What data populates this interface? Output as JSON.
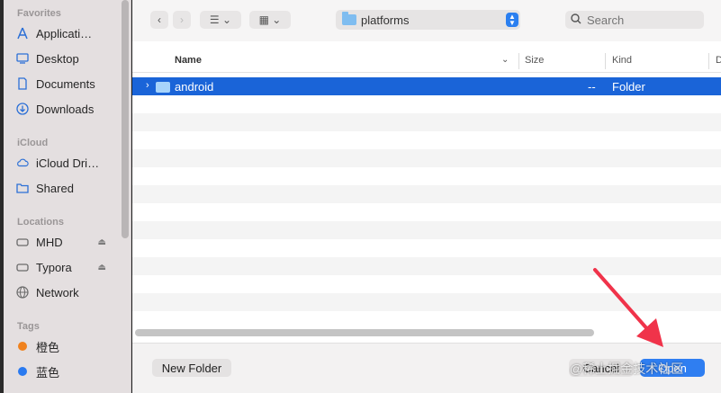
{
  "sidebar": {
    "favorites_title": "Favorites",
    "favorites": [
      {
        "label": "Applicati…",
        "icon": "applications-icon"
      },
      {
        "label": "Desktop",
        "icon": "desktop-icon"
      },
      {
        "label": "Documents",
        "icon": "documents-icon"
      },
      {
        "label": "Downloads",
        "icon": "downloads-icon"
      }
    ],
    "icloud_title": "iCloud",
    "icloud": [
      {
        "label": "iCloud Dri…",
        "icon": "cloud-icon"
      },
      {
        "label": "Shared",
        "icon": "shared-folder-icon"
      }
    ],
    "locations_title": "Locations",
    "locations": [
      {
        "label": "MHD",
        "icon": "drive-icon",
        "eject": "⏏"
      },
      {
        "label": "Typora",
        "icon": "drive-icon",
        "eject": "⏏"
      },
      {
        "label": "Network",
        "icon": "globe-icon"
      }
    ],
    "tags_title": "Tags",
    "tags": [
      {
        "label": "橙色",
        "color": "#f0821e"
      },
      {
        "label": "蓝色",
        "color": "#2a7af0"
      }
    ]
  },
  "toolbar": {
    "back": "‹",
    "forward": "›",
    "list_view": "☰ ⌄",
    "grid_view": "▦ ⌄",
    "path": "platforms",
    "search_placeholder": "Search"
  },
  "columns": {
    "name": "Name",
    "size": "Size",
    "kind": "Kind",
    "date": "D"
  },
  "files": [
    {
      "name": "android",
      "size": "--",
      "kind": "Folder",
      "selected": true
    }
  ],
  "footer": {
    "new_folder": "New Folder",
    "cancel": "Cancel",
    "open": "Open"
  },
  "watermark": "@稀土掘金技术社区",
  "colors": {
    "accent": "#1a64d8",
    "arrow": "#f0334a"
  }
}
